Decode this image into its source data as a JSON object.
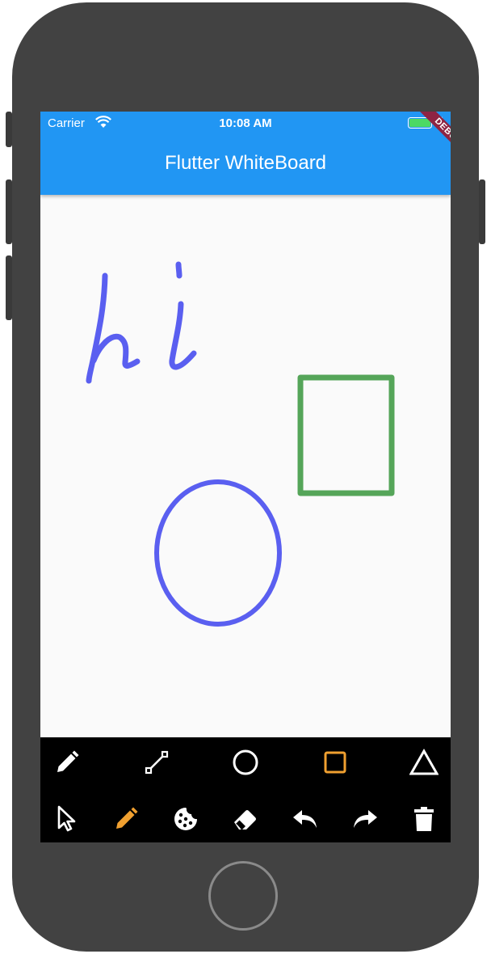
{
  "status_bar": {
    "carrier": "Carrier",
    "time": "10:08 AM"
  },
  "app_bar": {
    "title": "Flutter WhiteBoard",
    "color": "#2196f3"
  },
  "debug_banner": "DEBUG",
  "canvas": {
    "background": "#fafafa",
    "drawings": [
      {
        "kind": "freehand",
        "text": "hi",
        "color": "#5a5ff0"
      },
      {
        "kind": "rectangle",
        "color": "#55a559"
      },
      {
        "kind": "circle",
        "color": "#5a5ff0"
      }
    ]
  },
  "toolbar": {
    "row1": [
      {
        "icon": "pencil-icon",
        "name": "freehand-tool"
      },
      {
        "icon": "line-icon",
        "name": "line-tool"
      },
      {
        "icon": "circle-icon",
        "name": "circle-tool"
      },
      {
        "icon": "square-icon",
        "name": "rectangle-tool",
        "selected": true
      },
      {
        "icon": "triangle-icon",
        "name": "triangle-tool"
      }
    ],
    "row2": [
      {
        "icon": "cursor-icon",
        "name": "select-tool"
      },
      {
        "icon": "pencil-icon",
        "name": "pen-color-tool",
        "color": "#f0a030"
      },
      {
        "icon": "cookie-icon",
        "name": "fill-tool"
      },
      {
        "icon": "eraser-icon",
        "name": "eraser-tool"
      },
      {
        "icon": "undo-icon",
        "name": "undo-button"
      },
      {
        "icon": "redo-icon",
        "name": "redo-button"
      },
      {
        "icon": "trash-icon",
        "name": "clear-button"
      }
    ],
    "accent_color": "#f0a030"
  }
}
